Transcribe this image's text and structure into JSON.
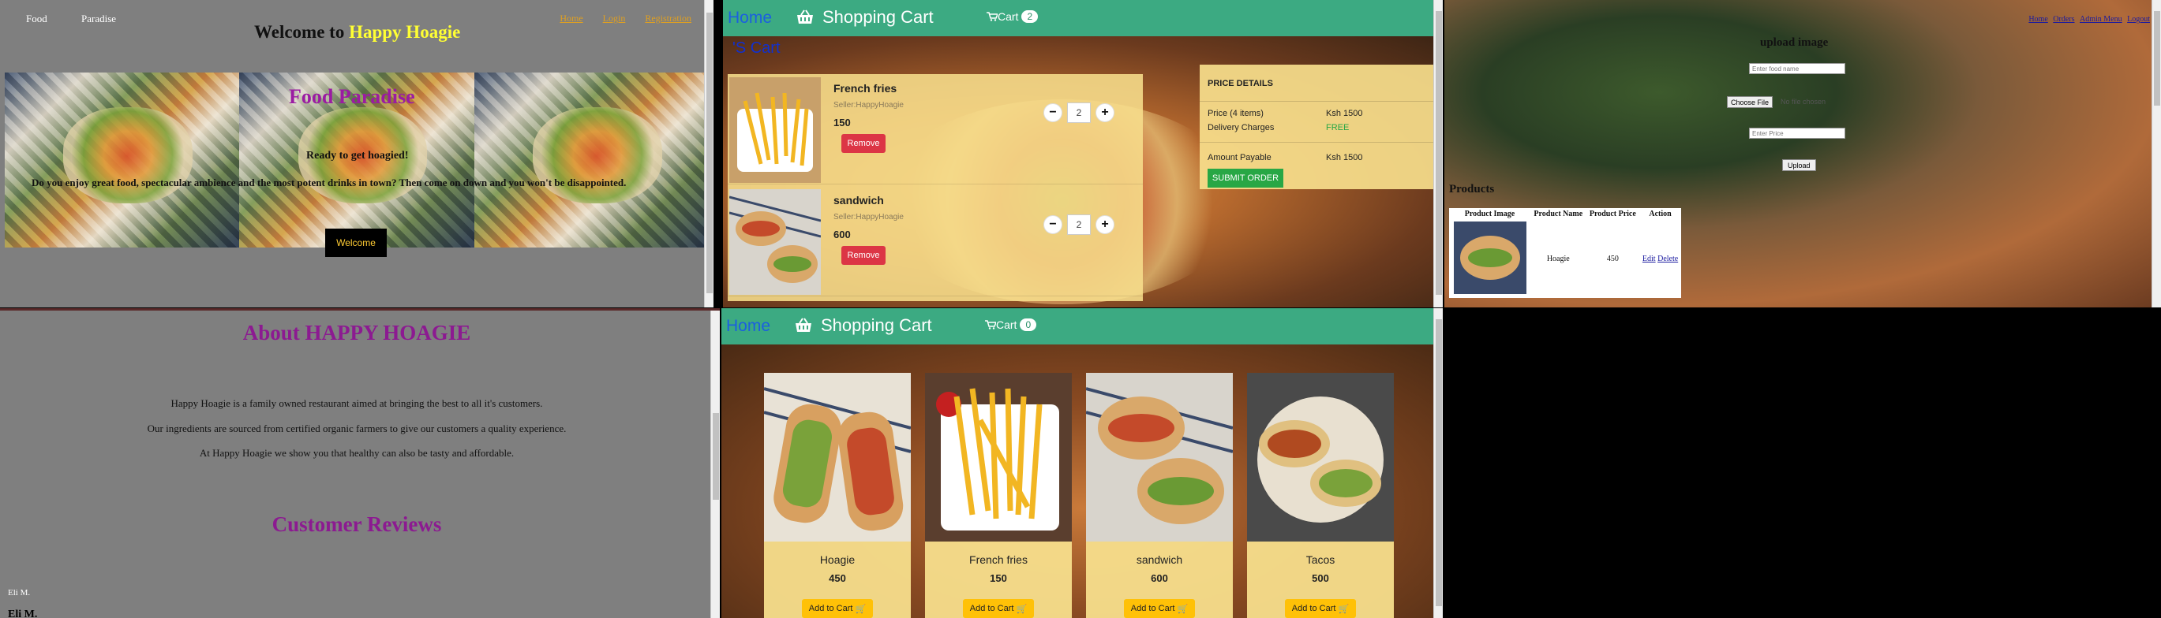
{
  "food_paradise": {
    "logo_alt": "Food",
    "logo_text": "Paradise",
    "title_prefix": "Welcome to",
    "title_highlight": "Happy Hoagie",
    "nav": [
      "Home",
      "Login",
      "Registration"
    ],
    "hero_title": "Food Paradise",
    "hero_sub": "Ready to get hoagied!",
    "hero_text": "Do you enjoy great food, spectacular ambience and the most potent drinks in town? Then come on down and you won't be disappointed.",
    "welcome_button": "Welcome"
  },
  "about": {
    "title": "About HAPPY HOAGIE",
    "paragraphs": [
      "Happy Hoagie is a family owned restaurant aimed at bringing the best to all it's customers.",
      "Our ingredients are sourced from certified organic farmers to give our customers a quality experience.",
      "At Happy Hoagie we show you that healthy can also be tasty and affordable."
    ],
    "reviews_title": "Customer Reviews",
    "reviewer_img_alt": "Eli M.",
    "reviewer_name": "Eli M."
  },
  "cart_page": {
    "home": "Home",
    "brand": "Shopping Cart",
    "cart_label": "Cart",
    "cart_count": "2",
    "heading_fragment": "'S Cart",
    "items": [
      {
        "name": "French fries",
        "seller": "Seller:HappyHoagie",
        "price": "150",
        "qty": "2",
        "remove": "Remove"
      },
      {
        "name": "sandwich",
        "seller": "Seller:HappyHoagie",
        "price": "600",
        "qty": "2",
        "remove": "Remove"
      }
    ],
    "price_details": {
      "title": "PRICE DETAILS",
      "price_label": "Price (4 items)",
      "price_value": "Ksh 1500",
      "delivery_label": "Delivery Charges",
      "delivery_value": "FREE",
      "payable_label": "Amount Payable",
      "payable_value": "Ksh 1500",
      "submit": "SUBMIT ORDER"
    }
  },
  "products_page": {
    "home": "Home",
    "brand": "Shopping Cart",
    "cart_label": "Cart",
    "cart_count": "0",
    "products": [
      {
        "name": "Hoagie",
        "price": "450",
        "button": "Add to Cart"
      },
      {
        "name": "French fries",
        "price": "150",
        "button": "Add to Cart"
      },
      {
        "name": "sandwich",
        "price": "600",
        "button": "Add to Cart"
      },
      {
        "name": "Tacos",
        "price": "500",
        "button": "Add to Cart"
      }
    ]
  },
  "admin": {
    "nav": [
      "Home",
      "Orders",
      "Admin Menu",
      "Logout"
    ],
    "upload_title": "upload image",
    "food_name_placeholder": "Enter food name",
    "choose_file": "Choose File",
    "no_file": "No file chosen",
    "price_placeholder": "Enter Price",
    "upload_button": "Upload",
    "products_title": "Products",
    "table_headers": [
      "Product Image",
      "Product Name",
      "Product Price",
      "Action"
    ],
    "rows": [
      {
        "name": "Hoagie",
        "price": "450",
        "edit": "Edit",
        "delete": "Delete"
      }
    ]
  },
  "colors": {
    "header_green": "#3caa82",
    "brand_purple": "#8c1a91",
    "remove_red": "#dc3545",
    "submit_green": "#28a745",
    "add_yellow": "#ffc107",
    "highlight_yellow": "#ffff33"
  }
}
